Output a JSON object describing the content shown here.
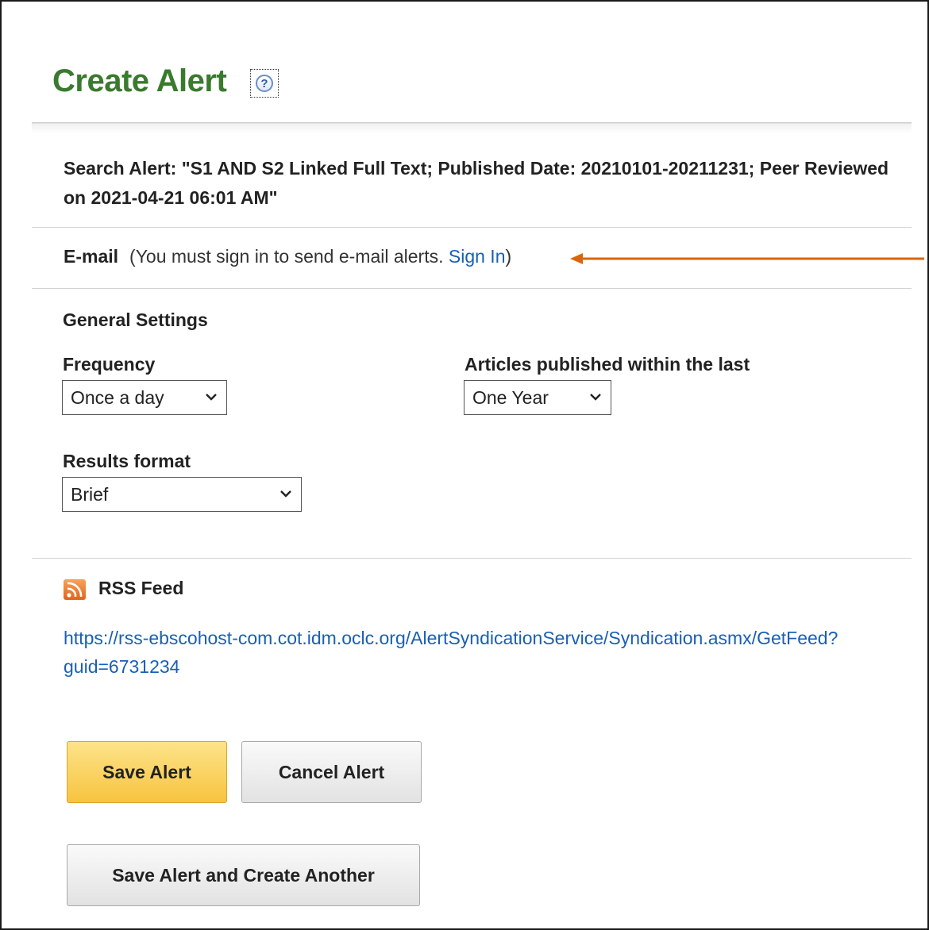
{
  "header": {
    "title": "Create Alert",
    "help_glyph": "?",
    "help_icon": "help-question-icon"
  },
  "search_alert": {
    "text": "Search Alert: \"S1 AND S2 Linked Full Text; Published Date: 20210101-20211231; Peer Reviewed on 2021-04-21 06:01 AM\""
  },
  "email": {
    "label": "E-mail",
    "note_prefix": "(You must sign in to send e-mail alerts. ",
    "sign_in_link": "Sign In",
    "note_suffix": ")",
    "annotation_arrow_color": "#d9660f"
  },
  "general_settings": {
    "heading": "General Settings",
    "frequency": {
      "label": "Frequency",
      "selected": "Once a day"
    },
    "articles_within": {
      "label": "Articles published within the last",
      "selected": "One Year"
    },
    "results_format": {
      "label": "Results format",
      "selected": "Brief"
    }
  },
  "rss": {
    "heading": "RSS Feed",
    "icon": "rss-feed-icon",
    "url": "https://rss-ebscohost-com.cot.idm.oclc.org/AlertSyndicationService/Syndication.asmx/GetFeed?guid=6731234"
  },
  "buttons": {
    "save": "Save Alert",
    "cancel": "Cancel Alert",
    "save_and_create": "Save Alert and Create Another"
  },
  "colors": {
    "title_green": "#3a7a2e",
    "link_blue": "#1a5fb4",
    "primary_button": "#f7c43f"
  }
}
